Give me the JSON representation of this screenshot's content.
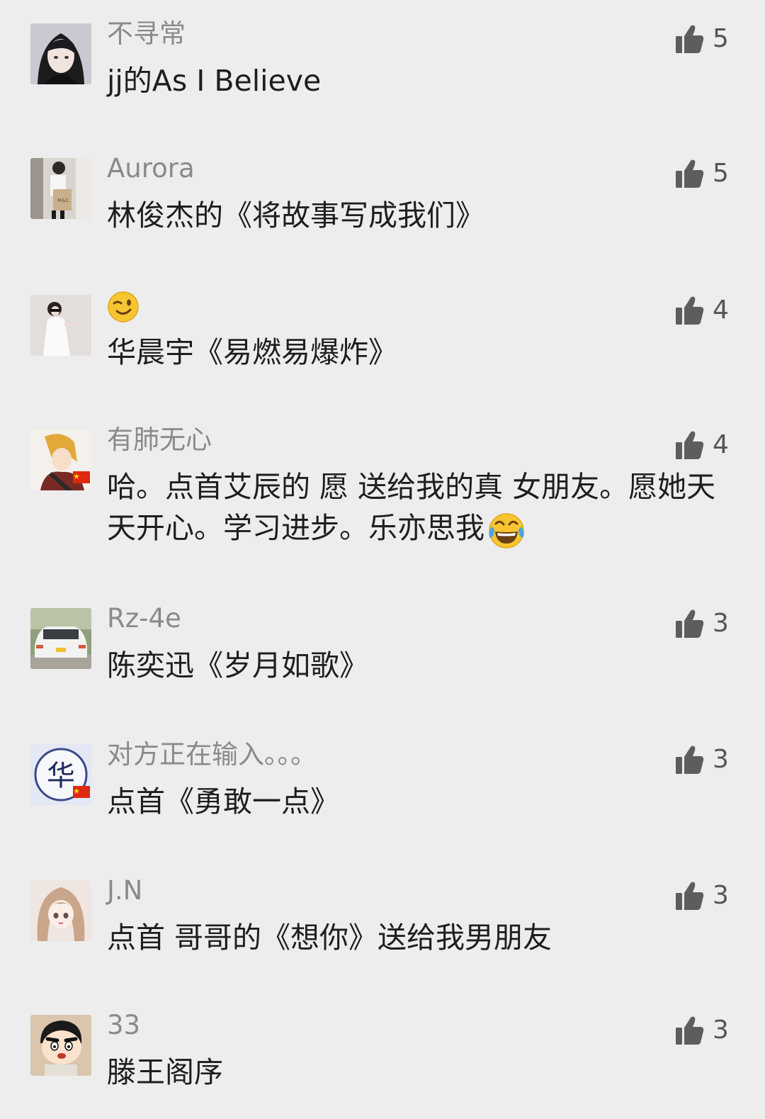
{
  "comments": [
    {
      "username": "不寻常",
      "content": "jj的As I Believe",
      "likes": "5",
      "avatar_icon": "girl-avatar-icon",
      "avatar_color": "#c9c9d1"
    },
    {
      "username": "Aurora",
      "content": "林俊杰的《将故事写成我们》",
      "likes": "5",
      "avatar_icon": "girl-with-bag-avatar-icon",
      "avatar_color": "#d8d4cf"
    },
    {
      "username": "😉",
      "content": "华晨宇《易燃易爆炸》",
      "likes": "4",
      "avatar_icon": "girl-white-dress-avatar-icon",
      "avatar_color": "#e2dedc"
    },
    {
      "username": "有肺无心",
      "content": "哈。点首艾辰的 愿 送给我的真 女朋友。愿她天天开心。学习进步。乐亦思我",
      "content_emoji": "😂",
      "likes": "4",
      "avatar_icon": "anime-character-avatar-icon",
      "avatar_color": "#f0dcc0"
    },
    {
      "username": "Rz-4e",
      "content": "陈奕迅《岁月如歌》",
      "likes": "3",
      "avatar_icon": "white-car-avatar-icon",
      "avatar_color": "#8fa07c"
    },
    {
      "username": "对方正在输入。。。",
      "content": "点首《勇敢一点》",
      "likes": "3",
      "avatar_icon": "hua-character-avatar-icon",
      "avatar_color": "#e3e8f4"
    },
    {
      "username": "J.N",
      "content": "点首 哥哥的《想你》送给我男朋友",
      "likes": "3",
      "avatar_icon": "anime-girl-avatar-icon",
      "avatar_color": "#efe6e2"
    },
    {
      "username": "33",
      "content": "滕王阁序",
      "likes": "3",
      "avatar_icon": "crayon-shinchan-avatar-icon",
      "avatar_color": "#d9c6ad"
    }
  ],
  "avatar_text": {
    "hua": "华"
  },
  "colors": {
    "like_icon": "#5d5d5d",
    "background": "#ededed",
    "username": "#8a8a8a",
    "content": "#1e1e1e"
  }
}
